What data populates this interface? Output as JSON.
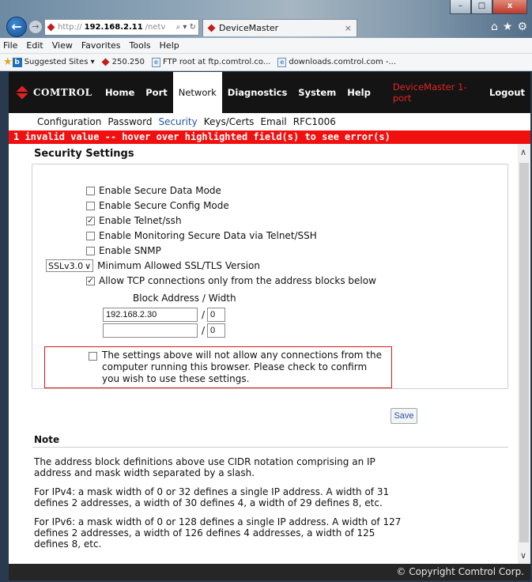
{
  "browser": {
    "address_proto": "http://",
    "address_host": "192.168.2.11",
    "address_rest": "/netv",
    "address_tools": "⌕ ▾ ↻",
    "tab_title": "DeviceMaster",
    "tab_close": "×",
    "win_minimize": "–",
    "win_maximize": "□",
    "win_close": "x",
    "menu": [
      "File",
      "Edit",
      "View",
      "Favorites",
      "Tools",
      "Help"
    ],
    "favorites": [
      {
        "label": "Suggested Sites ▾",
        "icon": "bing-icon"
      },
      {
        "label": "250.250",
        "icon": "comtrol-icon"
      },
      {
        "label": "FTP root at ftp.comtrol.co...",
        "icon": "page-icon"
      },
      {
        "label": "downloads.comtrol.com -...",
        "icon": "page-icon"
      }
    ]
  },
  "nav": {
    "logo": "COMTROL",
    "tabs": [
      "Home",
      "Port",
      "Network",
      "Diagnostics",
      "System",
      "Help"
    ],
    "active_tab": "Network",
    "device": "DeviceMaster 1-port",
    "logout": "Logout"
  },
  "subnav": {
    "items": [
      "Configuration",
      "Password",
      "Security",
      "Keys/Certs",
      "Email",
      "RFC1006"
    ],
    "active": "Security"
  },
  "error_banner": "1 invalid value -- hover over highlighted field(s) to see error(s)",
  "security": {
    "title": "Security Settings",
    "options": [
      {
        "label": "Enable Secure Data Mode",
        "checked": false
      },
      {
        "label": "Enable Secure Config Mode",
        "checked": false
      },
      {
        "label": "Enable Telnet/ssh",
        "checked": true
      },
      {
        "label": "Enable Monitoring Secure Data via Telnet/SSH",
        "checked": false
      },
      {
        "label": "Enable SNMP",
        "checked": false
      }
    ],
    "ssl_select": "SSLv3.0",
    "ssl_label": "Minimum Allowed SSL/TLS Version",
    "allow_tcp_label": "Allow TCP connections only from the address blocks below",
    "allow_tcp_checked": true,
    "block_label": "Block Address / Width",
    "blocks": [
      {
        "address": "192.168.2.30",
        "width": "0"
      },
      {
        "address": "",
        "width": "0"
      }
    ],
    "warning_lines": [
      "The settings above will not allow any connections from the",
      "computer running this browser. Please check to confirm",
      "you wish to use these settings."
    ],
    "save": "Save"
  },
  "note": {
    "title": "Note",
    "paragraphs": [
      [
        "The address block definitions above use CIDR notation comprising an IP",
        "address and mask width separated by a slash."
      ],
      [
        "For IPv4: a mask width of 0 or 32 defines a single IP address. A width of 31",
        "defines 2 addresses, a width of 30 defines 4, a width of 29 defines 8, etc."
      ],
      [
        "For IPv6: a mask width of 0 or 128 defines a single IP address. A width of 127",
        "defines 2 addresses, a width of 126 defines 4 addresses, a width of 125",
        "defines 8, etc."
      ]
    ]
  },
  "footer": "© Copyright Comtrol Corp.",
  "colors": {
    "error_red": "#f01010",
    "nav_black": "#141414",
    "active_link_blue": "#2156a5"
  }
}
